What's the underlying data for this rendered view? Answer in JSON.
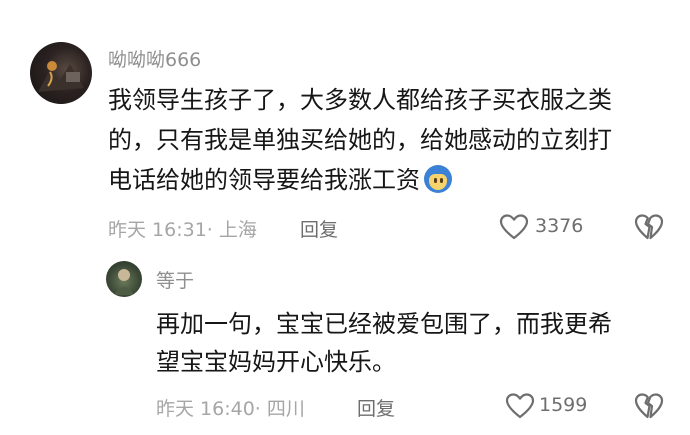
{
  "comment": {
    "username": "呦呦呦666",
    "lines": [
      "我领导生孩子了，大多数人都给孩子买衣服之类",
      "的，只有我是单独买给她的，给她感动的立刻打",
      "电话给她的领导要给我涨工资"
    ],
    "emoji": "blue-hair-face-emoji",
    "meta": "昨天 16:31· 上海",
    "reply_label": "回复",
    "like_count": "3376",
    "icons": {
      "like": "heart-icon",
      "dislike": "broken-heart-icon"
    }
  },
  "reply": {
    "username": "等于",
    "lines": [
      "再加一句，宝宝已经被爱包围了，而我更希",
      "望宝宝妈妈开心快乐。"
    ],
    "meta": "昨天 16:40· 四川",
    "reply_label": "回复",
    "like_count": "1599",
    "icons": {
      "like": "heart-icon",
      "dislike": "broken-heart-icon"
    }
  },
  "colors": {
    "text": "#161616",
    "secondary": "#8f8f8f",
    "meta": "#a6a6a6",
    "icon": "#6e6e6e"
  }
}
